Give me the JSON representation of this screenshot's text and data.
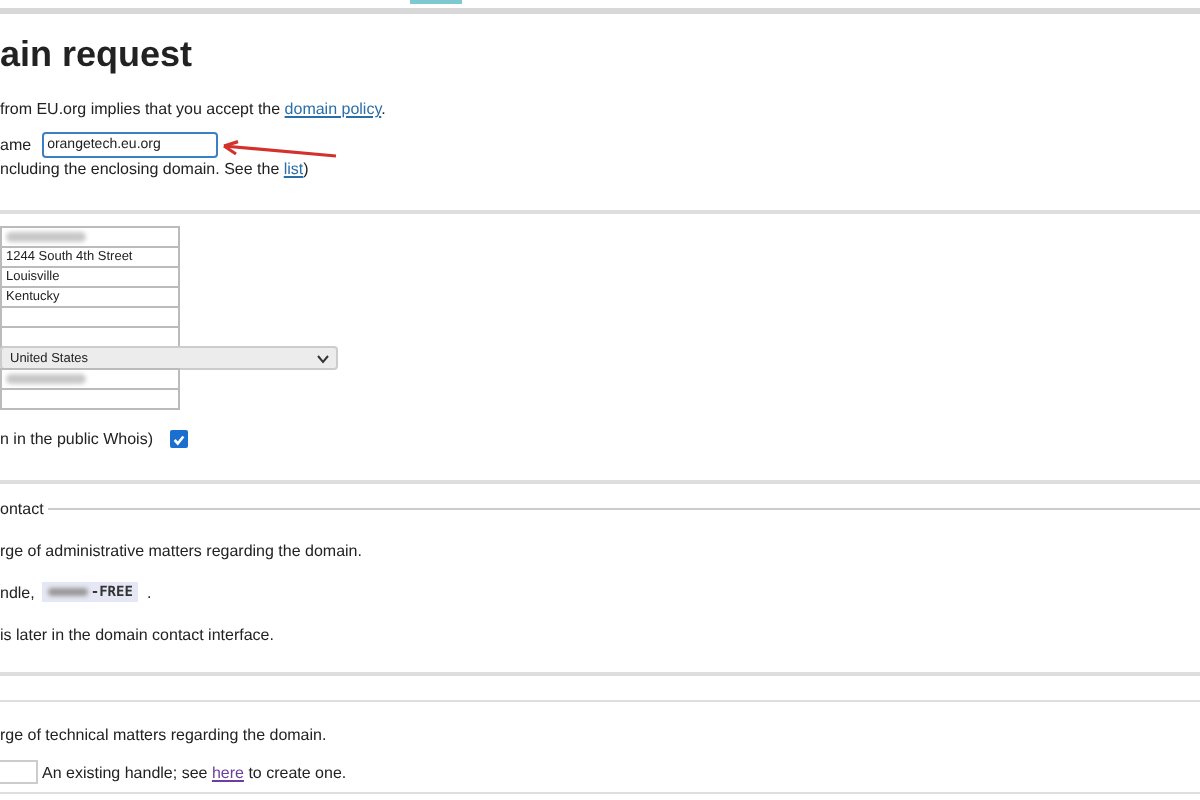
{
  "title": "ain request",
  "policy": {
    "before": "from EU.org implies that you accept the ",
    "link": "domain policy",
    "after": "."
  },
  "domain": {
    "label": "ame",
    "value": "orangetech.eu.org",
    "hint_before": "ncluding the enclosing domain. See the ",
    "hint_link": "list",
    "hint_after": ")"
  },
  "fields": [
    {
      "kind": "input",
      "redacted": true
    },
    {
      "kind": "input",
      "value": "1244 South 4th Street"
    },
    {
      "kind": "input",
      "value": "Louisville"
    },
    {
      "kind": "input",
      "value": "Kentucky"
    },
    {
      "kind": "input"
    },
    {
      "kind": "input"
    },
    {
      "kind": "select",
      "value": "United States"
    },
    {
      "kind": "input",
      "redacted": true
    },
    {
      "kind": "input"
    }
  ],
  "whois": {
    "label": "n in the public Whois)",
    "checked": true
  },
  "admin": {
    "legend": "ontact",
    "line1": "rge of administrative matters regarding the domain.",
    "handle_label": "ndle,",
    "handle": "-FREE",
    "handle_after": ".",
    "line3": "is later in the domain contact interface."
  },
  "tech": {
    "line1": "rge of technical matters regarding the domain.",
    "hint_before": "An existing handle; see ",
    "hint_link": "here",
    "hint_after": " to create one."
  }
}
